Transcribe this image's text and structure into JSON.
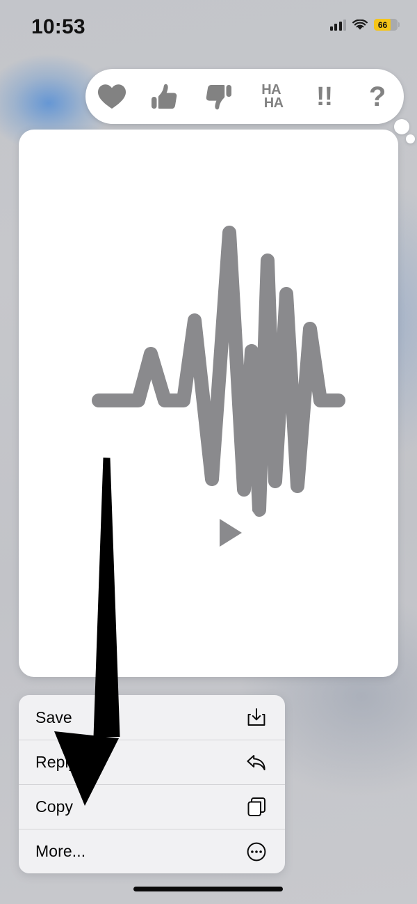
{
  "status_bar": {
    "time": "10:53",
    "battery_percent": "66",
    "battery_color": "#f5c518",
    "cellular_icon": "cellular-signal-icon",
    "wifi_icon": "wifi-icon",
    "battery_icon": "battery-icon"
  },
  "tapback_bar": {
    "reactions": [
      {
        "name": "heart-reaction",
        "icon": "heart-icon",
        "label": ""
      },
      {
        "name": "thumbs-up-reaction",
        "icon": "thumbs-up-icon",
        "label": ""
      },
      {
        "name": "thumbs-down-reaction",
        "icon": "thumbs-down-icon",
        "label": ""
      },
      {
        "name": "haha-reaction",
        "icon": "haha-text-icon",
        "label_line1": "HA",
        "label_line2": "HA"
      },
      {
        "name": "exclamation-reaction",
        "icon": "double-exclamation-icon",
        "label": "!!"
      },
      {
        "name": "question-reaction",
        "icon": "question-mark-icon",
        "label": "?"
      }
    ],
    "icon_color": "#828282",
    "background_color": "#ffffff"
  },
  "message_bubble": {
    "type": "audio-message",
    "waveform_color": "#8a8a8d",
    "background_color": "#ffffff",
    "play_button": "play-icon"
  },
  "context_menu": {
    "items": [
      {
        "label": "Save",
        "icon": "save-download-icon"
      },
      {
        "label": "Reply",
        "icon": "reply-arrow-icon"
      },
      {
        "label": "Copy",
        "icon": "copy-duplicate-icon"
      },
      {
        "label": "More...",
        "icon": "more-ellipsis-circle-icon"
      }
    ],
    "background_color": "#f2f2f5"
  },
  "annotation": {
    "type": "arrow",
    "color": "#000000",
    "points_to": "Copy"
  },
  "home_indicator": {
    "color": "#0a0a0a"
  }
}
